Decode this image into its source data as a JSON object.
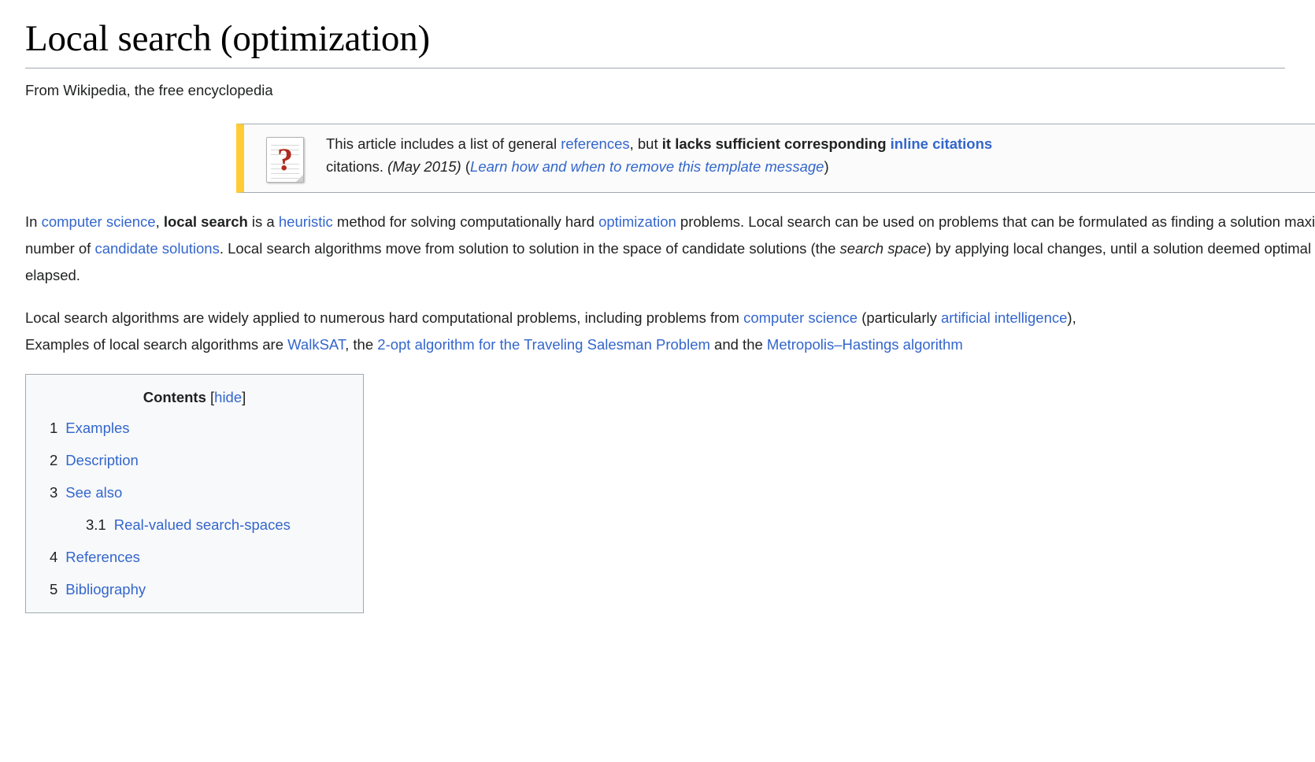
{
  "page": {
    "title": "Local search (optimization)",
    "subtitle": "From Wikipedia, the free encyclopedia"
  },
  "notice": {
    "icon": "document-question-mark-icon",
    "icon_glyph": "?",
    "accent_color": "#ffcc33",
    "background_color": "#fbfbfb",
    "border_color": "#a2a9b1",
    "line1_part1": "This article includes a list of general ",
    "line1_link1": "references",
    "line1_part2": ", but ",
    "line1_bold": "it lacks sufficient corresponding ",
    "line1_link2_bold": "inline citations",
    "line2_part1": "citations. ",
    "line2_date": "(May 2015)",
    "line2_paren_open": " (",
    "line2_learn_link": "Learn how and when to remove this template message",
    "line2_paren_close": ")"
  },
  "paragraphs": {
    "p1": {
      "s1": "In ",
      "l1": "computer science",
      "s2": ", ",
      "b1": "local search",
      "s3": " is a ",
      "l2": "heuristic",
      "s4": " method for solving computationally hard ",
      "l3": "optimization",
      "s5": " problems. Local search can be used on problems that can be formulated as finding a solution maximizing a criterion among a ",
      "s6": "number of ",
      "l4": "candidate solutions",
      "s7": ". Local search algorithms move from solution to solution in the space of candidate solutions (the ",
      "i1": "search space",
      "s8": ") by applying local changes, until a solution deemed optimal is found or a time bound is ",
      "s9": "elapsed."
    },
    "p2": {
      "s1": "Local search algorithms are widely applied to numerous hard computational problems, including problems from ",
      "l1": "computer science",
      "s2": " (particularly ",
      "l2": "artificial intelligence",
      "s3": "), ",
      "s4": "Examples of local search algorithms are ",
      "l3": "WalkSAT",
      "s5": ", the ",
      "l4": "2-opt algorithm for the Traveling Salesman Problem",
      "s6": " and the ",
      "l5": "Metropolis–Hastings algorithm"
    }
  },
  "toc": {
    "heading": "Contents",
    "bracket_open": "[",
    "toggle_label": "hide",
    "bracket_close": "]",
    "items": [
      {
        "number": "1",
        "label": "Examples",
        "level": 1
      },
      {
        "number": "2",
        "label": "Description",
        "level": 1
      },
      {
        "number": "3",
        "label": "See also",
        "level": 1
      },
      {
        "number": "3.1",
        "label": "Real-valued search-spaces",
        "level": 2
      },
      {
        "number": "4",
        "label": "References",
        "level": 1
      },
      {
        "number": "5",
        "label": "Bibliography",
        "level": 1
      }
    ]
  },
  "colors": {
    "link": "#3366cc",
    "text": "#202122",
    "toc_background": "#f8f9fa",
    "rule": "#a2a9b1"
  }
}
